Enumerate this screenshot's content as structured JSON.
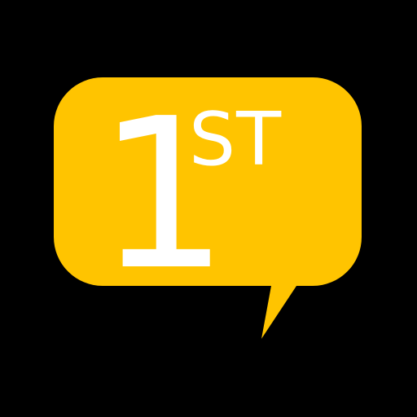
{
  "logo": {
    "numeral": "1",
    "suffix": "ST"
  },
  "colors": {
    "background": "#000000",
    "bubble": "#FFC400",
    "text": "#FFFFFF"
  },
  "icons": {
    "bubble": "speech-bubble-icon"
  }
}
